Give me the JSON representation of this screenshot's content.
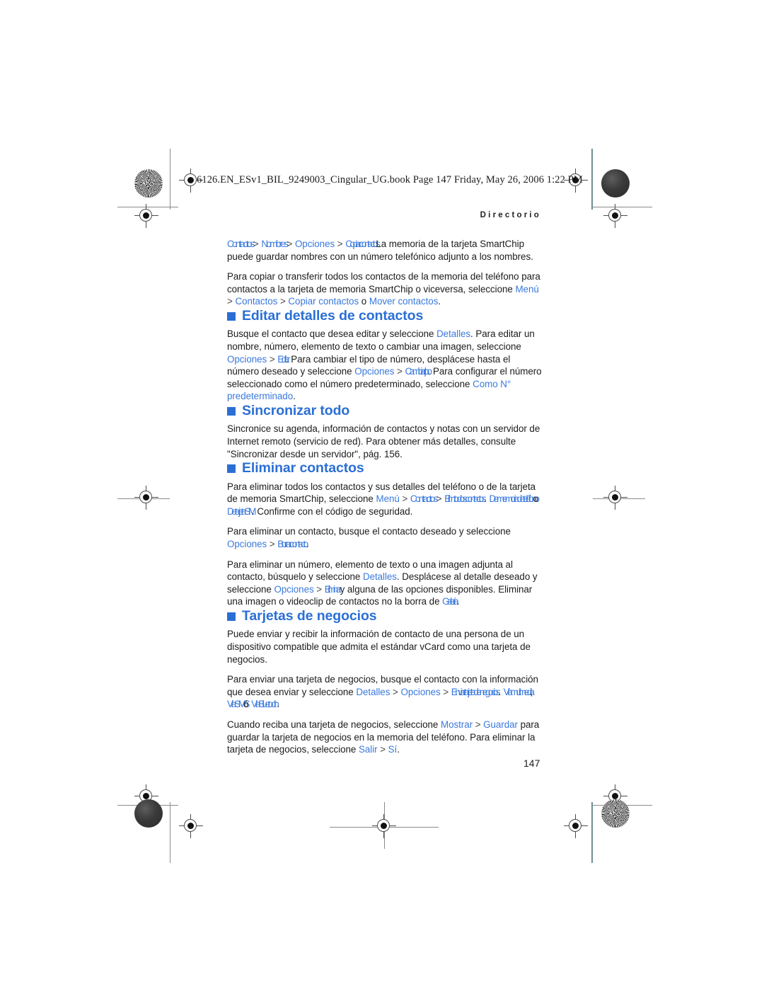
{
  "page": {
    "filename_strip": "6126.EN_ESv1_BIL_9249003_Cingular_UG.book  Page 147  Friday, May 26, 2006  1:22 PM",
    "running_head": "Directorio",
    "folio": "147",
    "accent_color": "#2b6fd4",
    "link_color": "#3a79dd",
    "text_color": "#1c1c1c"
  },
  "intro": {
    "line1": {
      "t1": "Contactos",
      "s1": ">",
      "t2": "Nombres",
      "s2": ">",
      "t3": "Opciones",
      "s3": ">",
      "t4": "Copiar contactos",
      "tail": "La memoria de la tarjeta"
    },
    "line2": "SmartChip puede guardar nombres con un número telefónico adjunto a los nombres.",
    "p2_a": "Para copiar o transferir todos los contactos de la memoria del teléfono para contactos a la tarjeta de memoria SmartChip o viceversa, seleccione ",
    "p2_menu": "Menú",
    "p2_s1": ">",
    "p2_contactos": "Contactos",
    "p2_s2": ">",
    "p2_copiar": "Copiar contactos",
    "p2_o": "o",
    "p2_mover": "Mover contactos",
    "p2_end": "."
  },
  "sections": [
    {
      "title": "Editar detalles de contactos",
      "paras": {
        "p1_a": "Busque el contacto que desea editar y seleccione ",
        "p1_detalles": "Detalles",
        "p1_b": ". Para editar un nombre, número, elemento de texto o cambiar una imagen, seleccione ",
        "p1_opciones": "Opciones",
        "p1_s": ">",
        "p1_editar": "Editar",
        "p1_c": ". Para cambiar el tipo de número, desplácese hasta el número deseado y seleccione ",
        "p1_opciones2": "Opciones",
        "p1_s2": ">",
        "p1_cambiar": "Cambiar tipo",
        "p1_d": ". Para configurar el número seleccionado como el número predeterminado, seleccione ",
        "p1_como": "Como N° predeterminado",
        "p1_e": "."
      }
    },
    {
      "title": "Sincronizar todo",
      "paras": {
        "p1": "Sincronice su agenda, información de contactos y notas con un servidor de Internet remoto (servicio de red). Para obtener más detalles, consulte \"Sincronizar desde un servidor\", pág. 156."
      }
    },
    {
      "title": "Eliminar contactos",
      "paras": {
        "p1_a": "Para eliminar todos los contactos y sus detalles del teléfono o de la tarjeta de memoria SmartChip, seleccione ",
        "p1_menu": "Menú",
        "p1_s1": ">",
        "p1_contactos": "Contactos",
        "p1_s2": ">",
        "p1_elim": "Elim. todos contactos",
        "p1_b": ".",
        "p1_dememoria": "De memoria de teléfono",
        "p1_o": "o",
        "p1_detarjeta": "De tarjeta SIM",
        "p1_c": ". Confirme con el código de seguridad.",
        "p2_a": "Para eliminar un contacto, busque el contacto deseado y seleccione ",
        "p2_opciones": "Opciones",
        "p2_s": ">",
        "p2_borrar": "Borrar contacto",
        "p2_b": ".",
        "p3_a": "Para eliminar un número, elemento de texto o una imagen adjunta al contacto, búsquelo y seleccione ",
        "p3_detalles": "Detalles",
        "p3_b": ". Desplácese al detalle deseado y seleccione ",
        "p3_opciones": "Opciones",
        "p3_s": ">",
        "p3_eliminar": "Eliminar",
        "p3_c": " y alguna de las opciones disponibles. Eliminar una imagen o videoclip de contactos no la borra de ",
        "p3_galeria": "Galería",
        "p3_d": "."
      }
    },
    {
      "title": "Tarjetas de negocios",
      "paras": {
        "p1": "Puede enviar y recibir la información de contacto de una persona de un dispositivo compatible que admita el estándar vCard como una tarjeta de negocios.",
        "p2_a": "Para enviar una tarjeta de negocios, busque el contacto con la información que desea enviar y seleccione ",
        "p2_detalles": "Detalles",
        "p2_s1": ">",
        "p2_opciones": "Opciones",
        "p2_s2": ">",
        "p2_enviar": "Enviar tarjeta de negocios",
        "p2_b": ".",
        "p2_multimedia": "Vía multimedia",
        "p2_c": ",",
        "p2_sms": "Vía SMS",
        "p2_o": "ó",
        "p2_bluetooth": "Vía Bluetooth",
        "p2_d": ".",
        "p3_a": "Cuando reciba una tarjeta de negocios, seleccione ",
        "p3_mostrar": "Mostrar",
        "p3_s": ">",
        "p3_guardar": "Guardar",
        "p3_b": " para guardar la tarjeta de negocios en la memoria del teléfono. Para eliminar la tarjeta de negocios, seleccione ",
        "p3_salir": "Salir",
        "p3_s2": ">",
        "p3_si": "Sí",
        "p3_c": "."
      }
    }
  ]
}
